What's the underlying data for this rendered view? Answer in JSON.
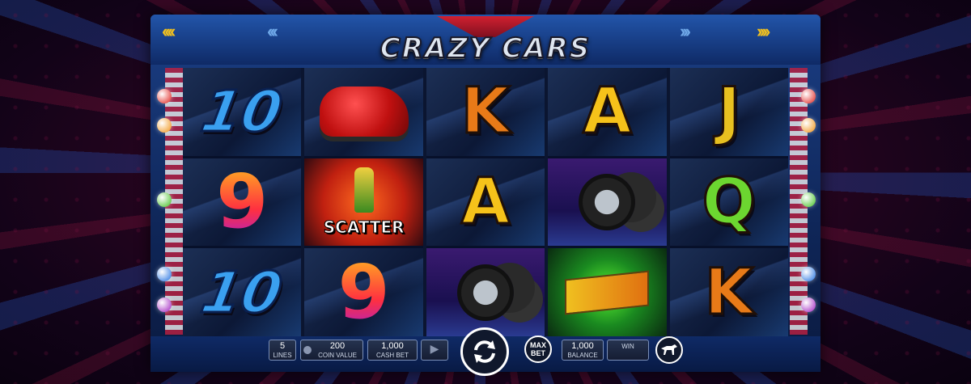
{
  "game": {
    "title": "CRAZY CARS"
  },
  "reels": [
    {
      "symbols": [
        {
          "type": "text",
          "label": "10",
          "class": "ten"
        },
        {
          "type": "text",
          "label": "9",
          "class": "nine"
        },
        {
          "type": "text",
          "label": "10",
          "class": "ten"
        }
      ]
    },
    {
      "symbols": [
        {
          "type": "image",
          "name": "red-car-symbol"
        },
        {
          "type": "scatter",
          "label": "SCATTER"
        },
        {
          "type": "text",
          "label": "9",
          "class": "nine"
        }
      ]
    },
    {
      "symbols": [
        {
          "type": "text",
          "label": "K",
          "class": "k"
        },
        {
          "type": "text",
          "label": "A",
          "class": "a"
        },
        {
          "type": "image",
          "name": "tires-symbol"
        }
      ]
    },
    {
      "symbols": [
        {
          "type": "text",
          "label": "A",
          "class": "a"
        },
        {
          "type": "image",
          "name": "tires-symbol"
        },
        {
          "type": "image",
          "name": "checkered-flag-symbol"
        }
      ]
    },
    {
      "symbols": [
        {
          "type": "text",
          "label": "J",
          "class": "j"
        },
        {
          "type": "text",
          "label": "Q",
          "class": "q"
        },
        {
          "type": "text",
          "label": "K",
          "class": "k"
        }
      ]
    }
  ],
  "controls": {
    "lines_value": "5",
    "lines_label": "LINES",
    "coin_value": "200",
    "coin_label": "COIN VALUE",
    "cash_bet_value": "1,000",
    "cash_bet_label": "CASH BET",
    "max_bet_label": "MAX\nBET",
    "balance_value": "1,000",
    "balance_label": "BALANCE",
    "win_value": "",
    "win_label": "WIN"
  },
  "icons": {
    "play": "play-icon",
    "spin": "spin-icon",
    "menu": "horse-logo-icon"
  },
  "colors": {
    "accent": "#f6c21a",
    "frame": "#1b3f86",
    "background": "#2a0520"
  }
}
